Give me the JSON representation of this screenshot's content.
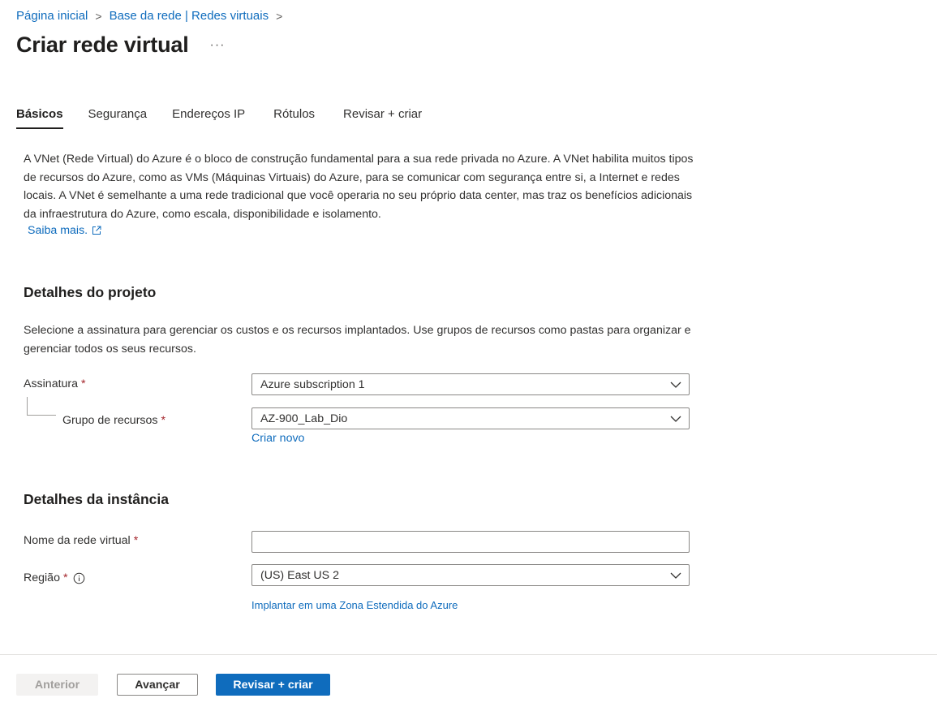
{
  "breadcrumb": {
    "items": [
      "Página inicial",
      "Base da rede | Redes virtuais"
    ],
    "separator": ">"
  },
  "page": {
    "title": "Criar rede virtual",
    "more_label": "···"
  },
  "tabs": [
    {
      "label": "Básicos",
      "active": true
    },
    {
      "label": "Segurança",
      "active": false
    },
    {
      "label": "Endereços IP",
      "active": false
    },
    {
      "label": "Rótulos",
      "active": false
    },
    {
      "label": "Revisar + criar",
      "active": false
    }
  ],
  "intro": {
    "text": "A VNet (Rede Virtual) do Azure é o bloco de construção fundamental para a sua rede privada no Azure. A VNet habilita muitos tipos de recursos do Azure, como as VMs (Máquinas Virtuais) do Azure, para se comunicar com segurança entre si, a Internet e redes locais. A VNet é semelhante a uma rede tradicional que você operaria no seu próprio data center, mas traz os benefícios adicionais da infraestrutura do Azure, como escala, disponibilidade e isolamento.",
    "learn_more": "Saiba mais.",
    "learn_more_icon": "external-link-icon"
  },
  "project_details": {
    "title": "Detalhes do projeto",
    "description": "Selecione a assinatura para gerenciar os custos e os recursos implantados. Use grupos de recursos como pastas para organizar e gerenciar todos os seus recursos.",
    "subscription": {
      "label": "Assinatura",
      "required": "*",
      "value": "Azure subscription 1"
    },
    "resource_group": {
      "label": "Grupo de recursos",
      "required": "*",
      "value": "AZ-900_Lab_Dio",
      "create_new": "Criar novo"
    }
  },
  "instance_details": {
    "title": "Detalhes da instância",
    "vnet_name": {
      "label": "Nome da rede virtual",
      "required": "*",
      "value": ""
    },
    "region": {
      "label": "Região",
      "required": "*",
      "info_icon": "info-icon",
      "value": "(US) East US 2",
      "extended_zone_link": "Implantar em uma Zona Estendida do Azure"
    }
  },
  "footer": {
    "previous": "Anterior",
    "next": "Avançar",
    "review_create": "Revisar + criar"
  },
  "colors": {
    "link": "#0f6cbd",
    "primary_button": "#0f6cbd",
    "required": "#a4262c",
    "disabled_button_bg": "#f3f2f1"
  }
}
